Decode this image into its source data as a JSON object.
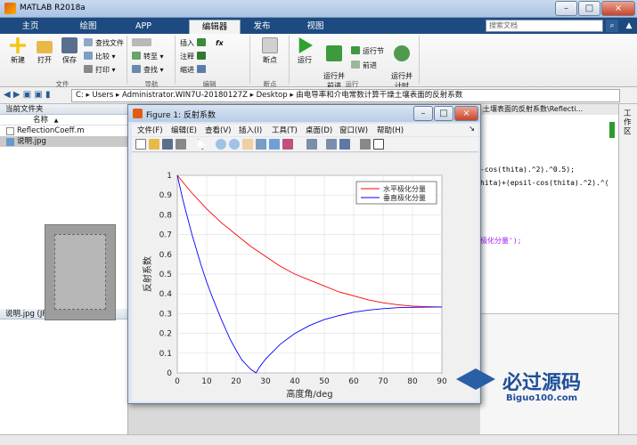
{
  "app": {
    "title": "MATLAB R2018a"
  },
  "window_controls": {
    "minimize": "–",
    "maximize": "□",
    "close": "×"
  },
  "tabs": [
    "主页",
    "绘图",
    "APP",
    "编辑器",
    "发布",
    "视图"
  ],
  "active_tab": "编辑器",
  "search": {
    "placeholder": "搜索文档",
    "button": "⌕",
    "collapse": "▲"
  },
  "ribbon": {
    "file_group": {
      "label": "文件",
      "new": "新建",
      "open": "打开",
      "save": "保存",
      "find_files": "查找文件",
      "compare": "比较",
      "print": "打印"
    },
    "nav_group": {
      "label": "导航",
      "goto": "转至",
      "find": "查找"
    },
    "edit_group": {
      "label": "编辑",
      "insert": "插入",
      "comment": "注释",
      "indent": "缩进",
      "fx": "fx"
    },
    "breakpoint_group": {
      "label": "断点",
      "breakpoints": "断点"
    },
    "run_group": {
      "label": "运行",
      "run": "运行",
      "run_advance": "运行并\n前进",
      "run_section": "运行节",
      "advance": "前进",
      "run_time": "运行并\n计时"
    }
  },
  "address": {
    "path": [
      "C:",
      "Users",
      "Administrator.WIN7U-20180127Z",
      "Desktop",
      "由电导率和介电常数计算干燥土壤表面的反射系数"
    ]
  },
  "left_panel": {
    "header": "当前文件夹",
    "column_name": "名称",
    "sort_arrow": "▲",
    "files": [
      {
        "name": "ReflectionCoeff.m",
        "selected": false
      },
      {
        "name": "说明.jpg",
        "selected": true
      }
    ],
    "details_header": "说明.jpg  (JPG 文件)"
  },
  "editor_tab": "土壤表面的反射系数\\Reflecti...",
  "workspace_label": "工作区",
  "editor_code": [
    "-cos(thita).^2).^0.5);",
    "hita)+(epsil-cos(thita).^2).^(",
    "",
    "",
    "",
    "",
    "极化分量');"
  ],
  "figure": {
    "title": "Figure 1: 反射系数",
    "menu": [
      "文件(F)",
      "编辑(E)",
      "查看(V)",
      "插入(I)",
      "工具(T)",
      "桌面(D)",
      "窗口(W)",
      "帮助(H)"
    ],
    "menu_arrow": "↘"
  },
  "chart_data": {
    "type": "line",
    "xlabel": "高度角/deg",
    "ylabel": "反射系数",
    "xlim": [
      0,
      90
    ],
    "ylim": [
      0,
      1
    ],
    "xticks": [
      0,
      10,
      20,
      30,
      40,
      50,
      60,
      70,
      80,
      90
    ],
    "yticks": [
      0,
      0.1,
      0.2,
      0.3,
      0.4,
      0.5,
      0.6,
      0.7,
      0.8,
      0.9,
      1
    ],
    "grid": true,
    "legend_position": "top-right",
    "series": [
      {
        "name": "水平极化分量",
        "color": "#ff0000",
        "x": [
          0,
          5,
          10,
          15,
          20,
          25,
          30,
          35,
          40,
          45,
          50,
          55,
          60,
          65,
          70,
          75,
          80,
          85,
          90
        ],
        "y": [
          1.0,
          0.91,
          0.83,
          0.76,
          0.7,
          0.64,
          0.59,
          0.54,
          0.5,
          0.47,
          0.44,
          0.41,
          0.39,
          0.37,
          0.355,
          0.345,
          0.338,
          0.335,
          0.334
        ]
      },
      {
        "name": "垂直极化分量",
        "color": "#0000ff",
        "x": [
          0,
          2,
          5,
          8,
          10,
          12,
          15,
          18,
          20,
          22,
          25,
          26.8,
          28,
          30,
          35,
          40,
          45,
          50,
          55,
          60,
          65,
          70,
          75,
          80,
          85,
          90
        ],
        "y": [
          1.0,
          0.87,
          0.7,
          0.55,
          0.46,
          0.38,
          0.27,
          0.17,
          0.115,
          0.065,
          0.018,
          0.0,
          0.03,
          0.07,
          0.145,
          0.2,
          0.24,
          0.27,
          0.29,
          0.307,
          0.318,
          0.325,
          0.33,
          0.332,
          0.333,
          0.334
        ]
      }
    ]
  },
  "watermark": {
    "text": "必过源码",
    "url": "Biguo100.com"
  },
  "colors": {
    "tab_bar": "#1d4a80",
    "ribbon": "#f3f3f3",
    "figure_frame": "#dde6f1"
  }
}
